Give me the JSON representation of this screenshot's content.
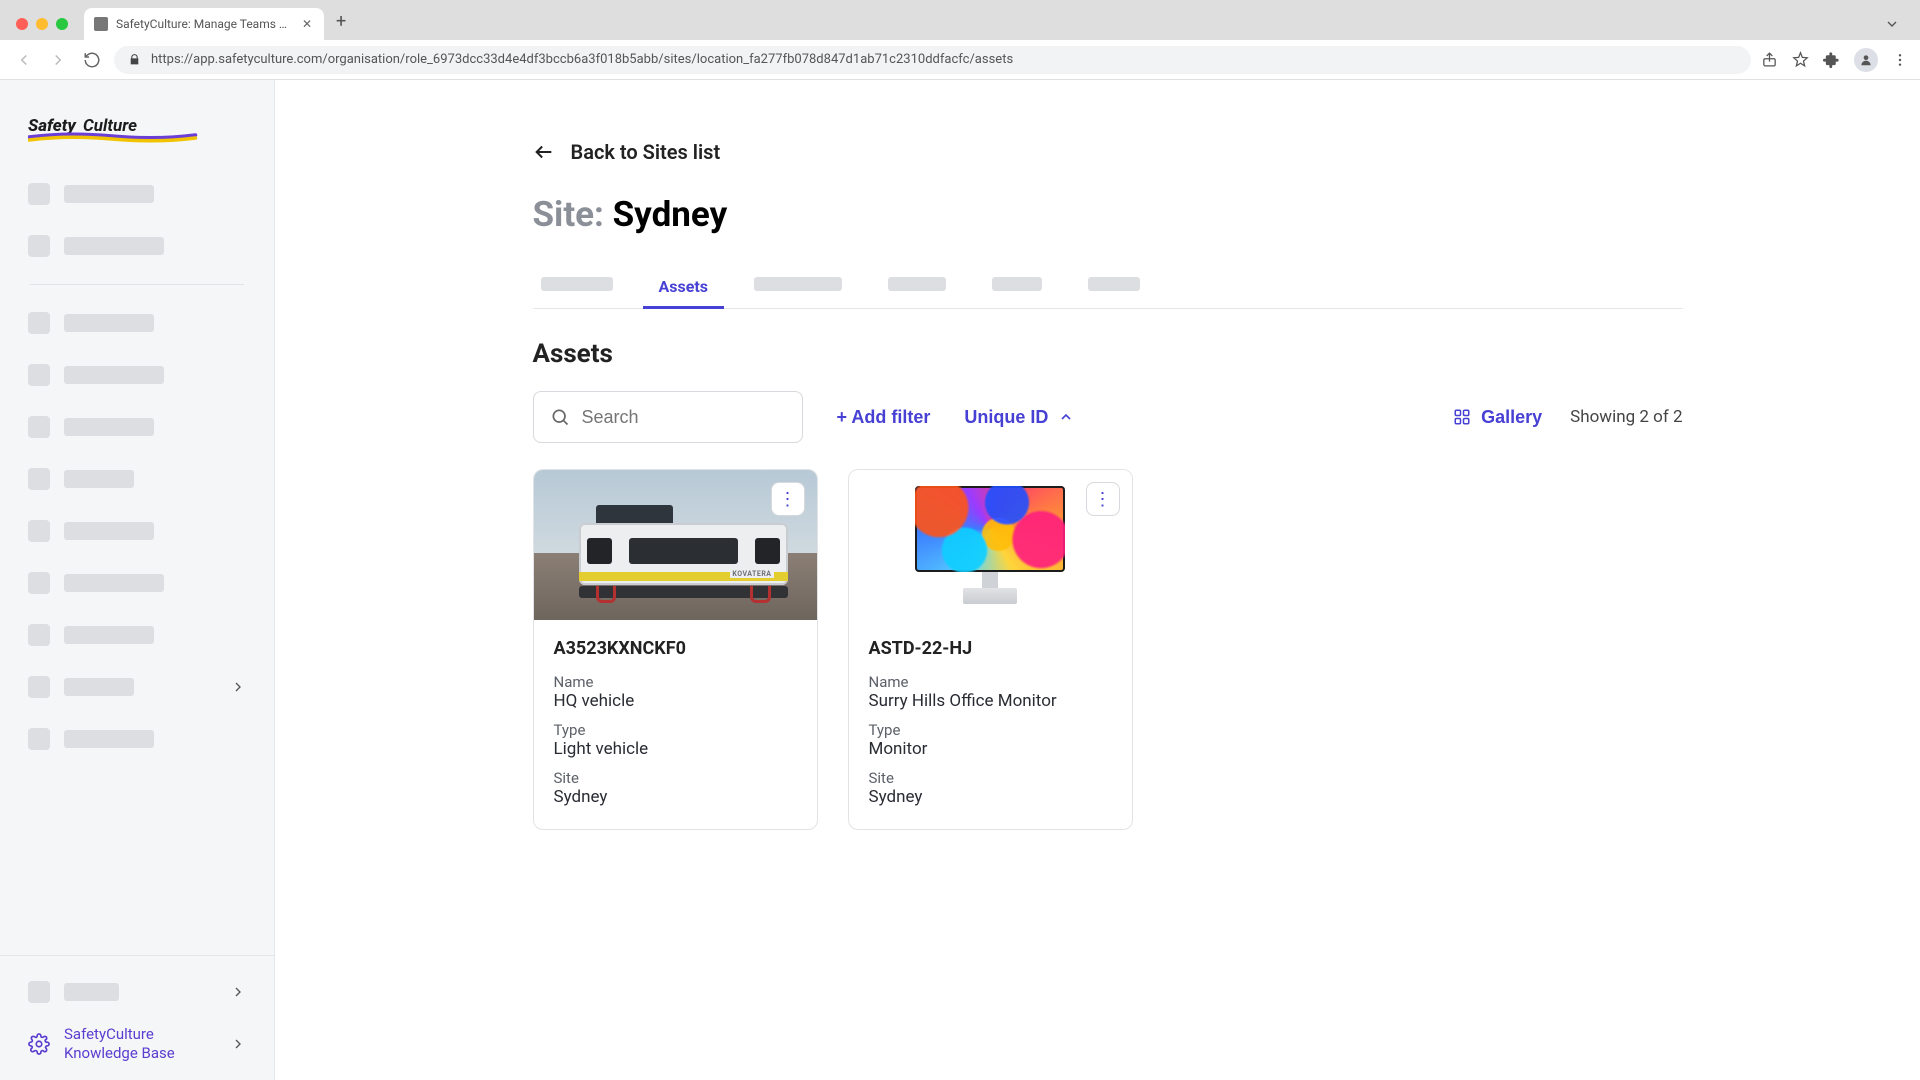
{
  "browser": {
    "tab_title": "SafetyCulture: Manage Teams and ...",
    "url": "https://app.safetyculture.com/organisation/role_6973dcc33d4e4df3bccb6a3f018b5abb/sites/location_fa277fb078d847d1ab71c2310ddfacfc/assets"
  },
  "brand": "SafetyCulture",
  "sidebar_bottom": {
    "knowledge_base_line1": "SafetyCulture",
    "knowledge_base_line2": "Knowledge Base"
  },
  "back_link": "Back to Sites list",
  "page_title_prefix": "Site:",
  "page_title_value": "Sydney",
  "active_tab": "Assets",
  "section_heading": "Assets",
  "search_placeholder": "Search",
  "add_filter": "+ Add filter",
  "sort": "Unique ID",
  "view_mode": "Gallery",
  "result_count": "Showing 2 of 2",
  "field_labels": {
    "name": "Name",
    "type": "Type",
    "site": "Site"
  },
  "assets": [
    {
      "id": "A3523KXNCKF0",
      "name": "HQ vehicle",
      "type": "Light vehicle",
      "site": "Sydney",
      "brand_tag": "KOVATERA"
    },
    {
      "id": "ASTD-22-HJ",
      "name": "Surry Hills Office Monitor",
      "type": "Monitor",
      "site": "Sydney"
    }
  ]
}
